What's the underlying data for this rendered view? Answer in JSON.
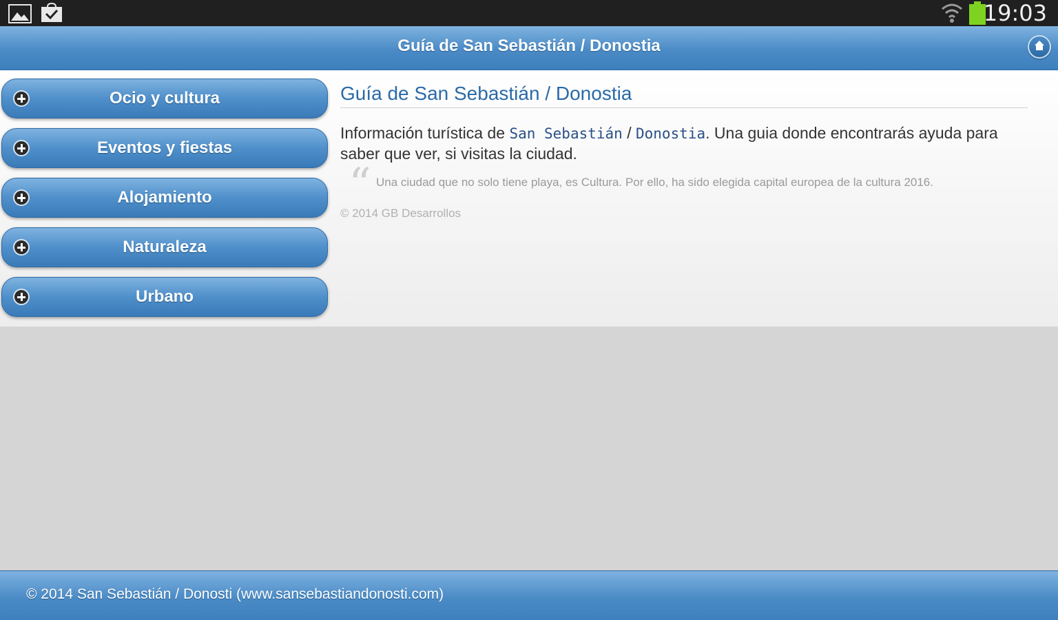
{
  "status_bar": {
    "time": "19:03",
    "icons": [
      "gallery-icon",
      "store-icon",
      "wifi-icon",
      "battery-icon"
    ],
    "battery_color": "#7ed321"
  },
  "header": {
    "title": "Guía de San Sebastián / Donostia",
    "home_icon": "home-icon"
  },
  "nav": {
    "items": [
      {
        "label": "Ocio y cultura",
        "icon": "plus-icon"
      },
      {
        "label": "Eventos y fiestas",
        "icon": "plus-icon"
      },
      {
        "label": "Alojamiento",
        "icon": "plus-icon"
      },
      {
        "label": "Naturaleza",
        "icon": "plus-icon"
      },
      {
        "label": "Urbano",
        "icon": "plus-icon"
      }
    ]
  },
  "main": {
    "heading": "Guía de San Sebastián / Donostia",
    "intro_prefix": "Información turística de ",
    "intro_code_1": "San Sebastián",
    "intro_sep": " / ",
    "intro_code_2": "Donostia",
    "intro_suffix": ". Una guia donde encontrarás ayuda para saber que ver, si visitas la ciudad.",
    "quote": "Una ciudad que no solo tiene playa, es Cultura. Por ello, ha sido elegida capital europea de la cultura 2016.",
    "copyright": "© 2014 GB Desarrollos"
  },
  "footer": {
    "text": "© 2014 San Sebastián / Donosti (www.sansebastiandonosti.com)"
  },
  "colors": {
    "accent": "#4a8bc6",
    "heading": "#2a6aa8",
    "status_bar": "#202020"
  }
}
